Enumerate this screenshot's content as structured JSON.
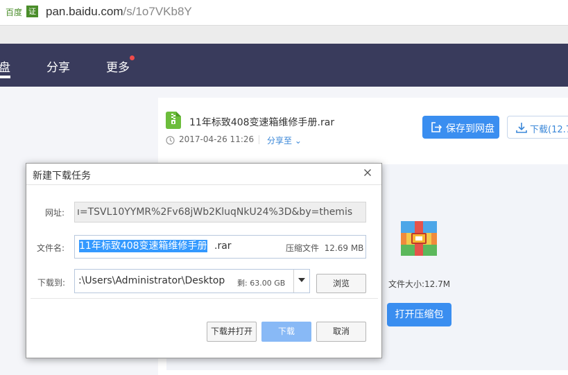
{
  "address_bar": {
    "site_label": "百度",
    "cert_label": "证",
    "url_host": "pan.baidu.com",
    "url_path": "/s/1o7VKb8Y"
  },
  "nav": {
    "items": [
      "盘",
      "分享",
      "更多"
    ],
    "active_index": 0,
    "notification_dot_color": "#f04b4b"
  },
  "file": {
    "name": "11年标致408变速箱维修手册.rar",
    "date": "2017-04-26 11:26",
    "share_to": "分享至",
    "save_button": "保存到网盘",
    "download_button": "下载(12.7",
    "size_text": "文件大小:12.7M",
    "open_zip_button": "打开压缩包"
  },
  "dialog": {
    "title": "新建下载任务",
    "url_label": "网址:",
    "url_value": "ı=TSVL10YYMR%2Fv68jWb2KluqNkU24%3D&by=themis",
    "filename_label": "文件名:",
    "filename_selected": "11年标致408变速箱维修手册",
    "filename_ext": ".rar",
    "file_type": "压缩文件",
    "file_size": "12.69 MB",
    "path_label": "下载到:",
    "path_value": ":\\Users\\Administrator\\Desktop",
    "free_space": "剩: 63.00 GB",
    "browse_button": "浏览",
    "download_open_button": "下载并打开",
    "download_button": "下载",
    "cancel_button": "取消"
  },
  "colors": {
    "nav_bg": "#393b5c",
    "accent_blue": "#3a8ef0",
    "selection": "#3399ff"
  }
}
